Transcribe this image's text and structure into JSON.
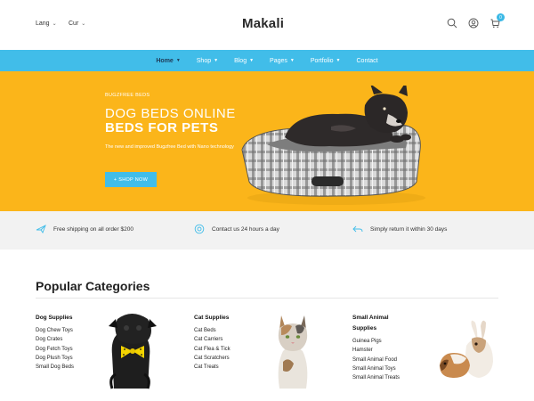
{
  "header": {
    "lang_label": "Lang",
    "cur_label": "Cur",
    "logo_text": "akali",
    "logo_mark": "M",
    "cart_count": "0",
    "icons": [
      "search-icon",
      "user-icon",
      "cart-icon"
    ]
  },
  "nav": {
    "items": [
      {
        "label": "Home"
      },
      {
        "label": "Shop"
      },
      {
        "label": "Blog"
      },
      {
        "label": "Pages"
      },
      {
        "label": "Portfolio"
      },
      {
        "label": "Contact"
      }
    ]
  },
  "hero": {
    "eyebrow": "BUGZFREE BEDS",
    "title_line1": "DOG BEDS ONLINE",
    "title_line2": "BEDS FOR PETS",
    "description": "The new and improved Bugzfree Bed with Nano technology",
    "button": "+ SHOP NOW"
  },
  "features": [
    {
      "text": "Free shipping on all order $200",
      "icon": "plane-icon"
    },
    {
      "text": "Contact us 24 hours a day",
      "icon": "support-icon"
    },
    {
      "text": "Simply return it within 30 days",
      "icon": "return-icon"
    }
  ],
  "categories": {
    "title": "Popular Categories",
    "columns": [
      {
        "heading": "Dog Supplies",
        "links": [
          "Dog Chew Toys",
          "Dog Crates",
          "Dog Fetch Toys",
          "Dog Plush Toys",
          "Small Dog Beds"
        ]
      },
      {
        "heading": "Cat Supplies",
        "links": [
          "Cat Beds",
          "Cat Carriers",
          "Cat Flea & Tick",
          "Cat Scratchers",
          "Cat Treats"
        ]
      },
      {
        "heading_line1": "Small Animal",
        "heading_line2": "Supplies",
        "links": [
          "Guinea Pigs",
          "Hamster",
          "Small Animal Food",
          "Small Animal Toys",
          "Small Animal Treats"
        ]
      }
    ]
  },
  "colors": {
    "accent": "#41bde9",
    "hero_bg": "#fbb51a",
    "features_bg": "#f2f2f2"
  }
}
